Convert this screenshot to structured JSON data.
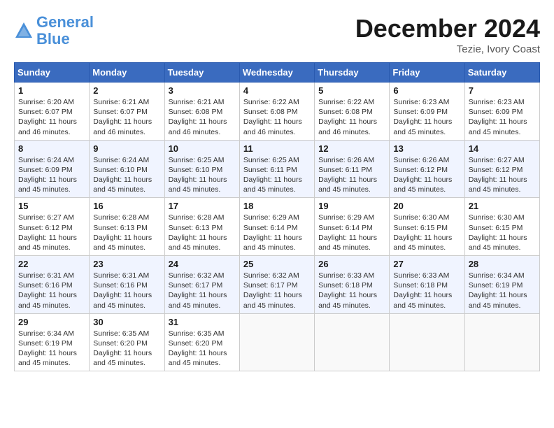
{
  "header": {
    "logo_line1": "General",
    "logo_line2": "Blue",
    "month": "December 2024",
    "location": "Tezie, Ivory Coast"
  },
  "days_of_week": [
    "Sunday",
    "Monday",
    "Tuesday",
    "Wednesday",
    "Thursday",
    "Friday",
    "Saturday"
  ],
  "weeks": [
    [
      {
        "day": "1",
        "sunrise": "6:20 AM",
        "sunset": "6:07 PM",
        "daylight": "11 hours and 46 minutes."
      },
      {
        "day": "2",
        "sunrise": "6:21 AM",
        "sunset": "6:07 PM",
        "daylight": "11 hours and 46 minutes."
      },
      {
        "day": "3",
        "sunrise": "6:21 AM",
        "sunset": "6:08 PM",
        "daylight": "11 hours and 46 minutes."
      },
      {
        "day": "4",
        "sunrise": "6:22 AM",
        "sunset": "6:08 PM",
        "daylight": "11 hours and 46 minutes."
      },
      {
        "day": "5",
        "sunrise": "6:22 AM",
        "sunset": "6:08 PM",
        "daylight": "11 hours and 46 minutes."
      },
      {
        "day": "6",
        "sunrise": "6:23 AM",
        "sunset": "6:09 PM",
        "daylight": "11 hours and 45 minutes."
      },
      {
        "day": "7",
        "sunrise": "6:23 AM",
        "sunset": "6:09 PM",
        "daylight": "11 hours and 45 minutes."
      }
    ],
    [
      {
        "day": "8",
        "sunrise": "6:24 AM",
        "sunset": "6:09 PM",
        "daylight": "11 hours and 45 minutes."
      },
      {
        "day": "9",
        "sunrise": "6:24 AM",
        "sunset": "6:10 PM",
        "daylight": "11 hours and 45 minutes."
      },
      {
        "day": "10",
        "sunrise": "6:25 AM",
        "sunset": "6:10 PM",
        "daylight": "11 hours and 45 minutes."
      },
      {
        "day": "11",
        "sunrise": "6:25 AM",
        "sunset": "6:11 PM",
        "daylight": "11 hours and 45 minutes."
      },
      {
        "day": "12",
        "sunrise": "6:26 AM",
        "sunset": "6:11 PM",
        "daylight": "11 hours and 45 minutes."
      },
      {
        "day": "13",
        "sunrise": "6:26 AM",
        "sunset": "6:12 PM",
        "daylight": "11 hours and 45 minutes."
      },
      {
        "day": "14",
        "sunrise": "6:27 AM",
        "sunset": "6:12 PM",
        "daylight": "11 hours and 45 minutes."
      }
    ],
    [
      {
        "day": "15",
        "sunrise": "6:27 AM",
        "sunset": "6:12 PM",
        "daylight": "11 hours and 45 minutes."
      },
      {
        "day": "16",
        "sunrise": "6:28 AM",
        "sunset": "6:13 PM",
        "daylight": "11 hours and 45 minutes."
      },
      {
        "day": "17",
        "sunrise": "6:28 AM",
        "sunset": "6:13 PM",
        "daylight": "11 hours and 45 minutes."
      },
      {
        "day": "18",
        "sunrise": "6:29 AM",
        "sunset": "6:14 PM",
        "daylight": "11 hours and 45 minutes."
      },
      {
        "day": "19",
        "sunrise": "6:29 AM",
        "sunset": "6:14 PM",
        "daylight": "11 hours and 45 minutes."
      },
      {
        "day": "20",
        "sunrise": "6:30 AM",
        "sunset": "6:15 PM",
        "daylight": "11 hours and 45 minutes."
      },
      {
        "day": "21",
        "sunrise": "6:30 AM",
        "sunset": "6:15 PM",
        "daylight": "11 hours and 45 minutes."
      }
    ],
    [
      {
        "day": "22",
        "sunrise": "6:31 AM",
        "sunset": "6:16 PM",
        "daylight": "11 hours and 45 minutes."
      },
      {
        "day": "23",
        "sunrise": "6:31 AM",
        "sunset": "6:16 PM",
        "daylight": "11 hours and 45 minutes."
      },
      {
        "day": "24",
        "sunrise": "6:32 AM",
        "sunset": "6:17 PM",
        "daylight": "11 hours and 45 minutes."
      },
      {
        "day": "25",
        "sunrise": "6:32 AM",
        "sunset": "6:17 PM",
        "daylight": "11 hours and 45 minutes."
      },
      {
        "day": "26",
        "sunrise": "6:33 AM",
        "sunset": "6:18 PM",
        "daylight": "11 hours and 45 minutes."
      },
      {
        "day": "27",
        "sunrise": "6:33 AM",
        "sunset": "6:18 PM",
        "daylight": "11 hours and 45 minutes."
      },
      {
        "day": "28",
        "sunrise": "6:34 AM",
        "sunset": "6:19 PM",
        "daylight": "11 hours and 45 minutes."
      }
    ],
    [
      {
        "day": "29",
        "sunrise": "6:34 AM",
        "sunset": "6:19 PM",
        "daylight": "11 hours and 45 minutes."
      },
      {
        "day": "30",
        "sunrise": "6:35 AM",
        "sunset": "6:20 PM",
        "daylight": "11 hours and 45 minutes."
      },
      {
        "day": "31",
        "sunrise": "6:35 AM",
        "sunset": "6:20 PM",
        "daylight": "11 hours and 45 minutes."
      },
      null,
      null,
      null,
      null
    ]
  ]
}
